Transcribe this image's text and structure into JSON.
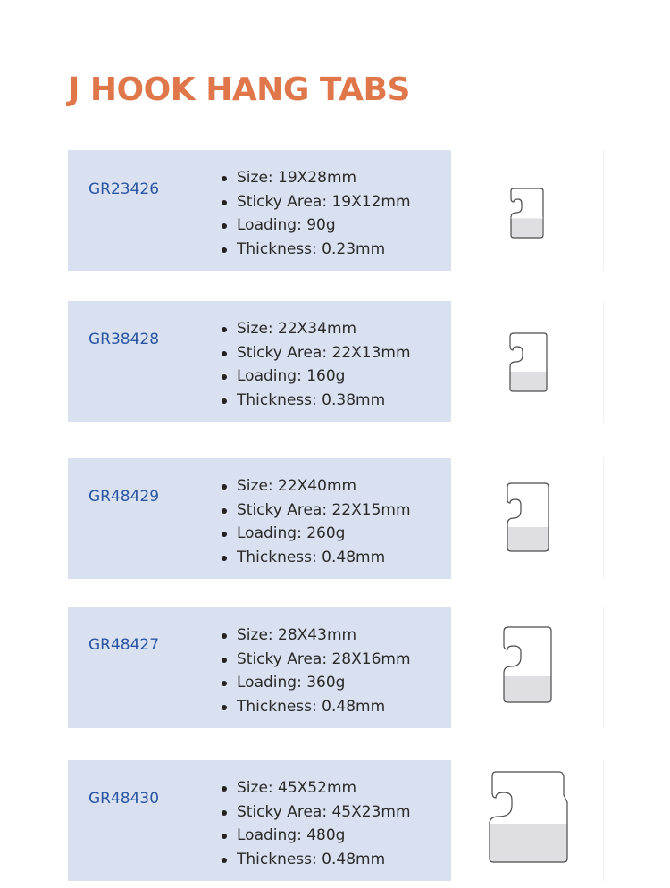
{
  "title": "J HOOK HANG TABS",
  "items": [
    {
      "code": "GR23426",
      "specs": [
        "Size: 19X28mm",
        "Sticky Area: 19X12mm",
        "Loading: 90g",
        "Thickness: 0.23mm"
      ]
    },
    {
      "code": "GR38428",
      "specs": [
        "Size: 22X34mm",
        "Sticky Area: 22X13mm",
        "Loading: 160g",
        "Thickness: 0.38mm"
      ]
    },
    {
      "code": "GR48429",
      "specs": [
        "Size: 22X40mm",
        "Sticky Area: 22X15mm",
        "Loading: 260g",
        "Thickness: 0.48mm"
      ]
    },
    {
      "code": "GR48427",
      "specs": [
        "Size: 28X43mm",
        "Sticky Area: 28X16mm",
        "Loading: 360g",
        "Thickness: 0.48mm"
      ]
    },
    {
      "code": "GR48430",
      "specs": [
        "Size: 45X52mm",
        "Sticky Area: 45X23mm",
        "Loading: 480g",
        "Thickness: 0.48mm"
      ]
    }
  ],
  "colors": {
    "title": "#e0774b",
    "code": "#2a55a3",
    "panel": "#d9e0f0",
    "sticky_area": "#dfdfe1",
    "outline": "#4a4a4a"
  },
  "icon": "j-hook-hang-tab-icon"
}
